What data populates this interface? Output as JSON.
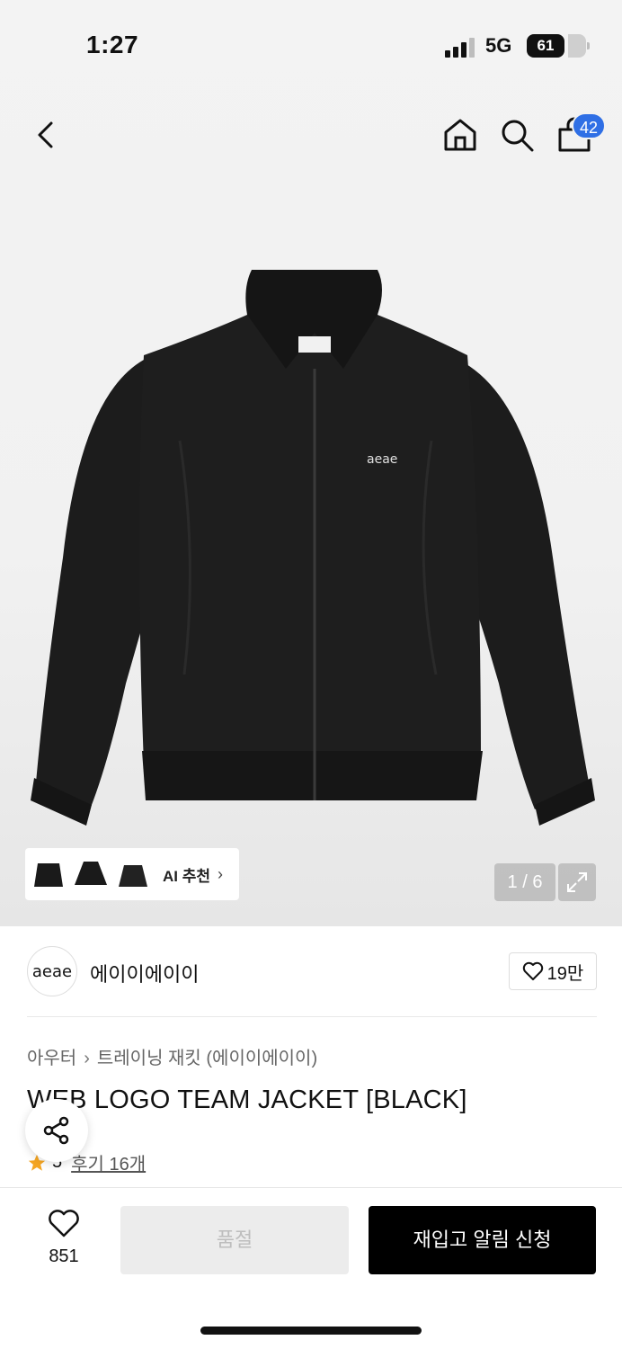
{
  "status_bar": {
    "time": "1:27",
    "network": "5G",
    "battery": "61"
  },
  "nav": {
    "back_icon": "chevron-left-icon",
    "home_icon": "home-icon",
    "search_icon": "search-icon",
    "cart_icon": "shopping-bag-icon",
    "cart_count": "42"
  },
  "gallery": {
    "ai_label": "AI 추천",
    "page_indicator": "1 / 6"
  },
  "brand": {
    "logo_text": "aeae",
    "name": "에이이에이이",
    "likes": "19만"
  },
  "breadcrumb": {
    "category": "아우터",
    "subcategory": "트레이닝 재킷 (에이이에이이)"
  },
  "product": {
    "title": "WEB LOGO TEAM JACKET [BLACK]",
    "rating": "5",
    "reviews": "후기 16개"
  },
  "bottom_bar": {
    "wish_count": "851",
    "soldout_label": "품절",
    "restock_label": "재입고 알림 신청"
  },
  "colors": {
    "accent": "#2f6fe5",
    "star": "#f5a623",
    "primary_button": "#000000",
    "disabled_button": "#ececec"
  }
}
